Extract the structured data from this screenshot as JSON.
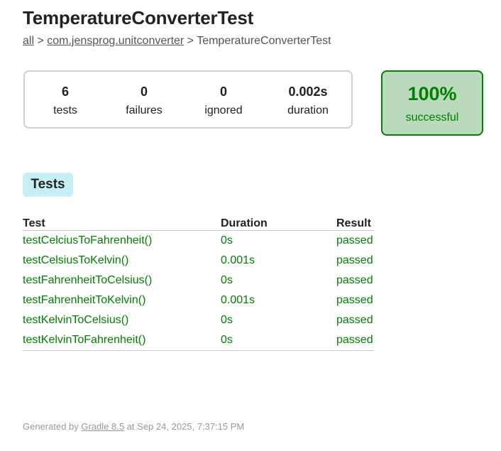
{
  "page": {
    "title": "TemperatureConverterTest"
  },
  "breadcrumb": {
    "all_label": "all",
    "sep1": " > ",
    "package_label": "com.jensprog.unitconverter",
    "sep2": " > ",
    "current": "TemperatureConverterTest"
  },
  "summary": {
    "tests": {
      "value": "6",
      "label": "tests"
    },
    "failures": {
      "value": "0",
      "label": "failures"
    },
    "ignored": {
      "value": "0",
      "label": "ignored"
    },
    "duration": {
      "value": "0.002s",
      "label": "duration"
    }
  },
  "success": {
    "rate": "100%",
    "label": "successful",
    "color": "#008000",
    "background": "#bbd9bb"
  },
  "tabs": {
    "tests_label": "Tests"
  },
  "table": {
    "headers": {
      "test": "Test",
      "duration": "Duration",
      "result": "Result"
    },
    "rows": [
      {
        "test": "testCelciusToFahrenheit()",
        "duration": "0s",
        "result": "passed"
      },
      {
        "test": "testCelsiusToKelvin()",
        "duration": "0.001s",
        "result": "passed"
      },
      {
        "test": "testFahrenheitToCelsius()",
        "duration": "0s",
        "result": "passed"
      },
      {
        "test": "testFahrenheitToKelvin()",
        "duration": "0.001s",
        "result": "passed"
      },
      {
        "test": "testKelvinToCelsius()",
        "duration": "0s",
        "result": "passed"
      },
      {
        "test": "testKelvinToFahrenheit()",
        "duration": "0s",
        "result": "passed"
      }
    ]
  },
  "footer": {
    "prefix": "Generated by ",
    "link": "Gradle 8.5",
    "suffix": " at Sep 24, 2025, 7:37:15 PM"
  }
}
